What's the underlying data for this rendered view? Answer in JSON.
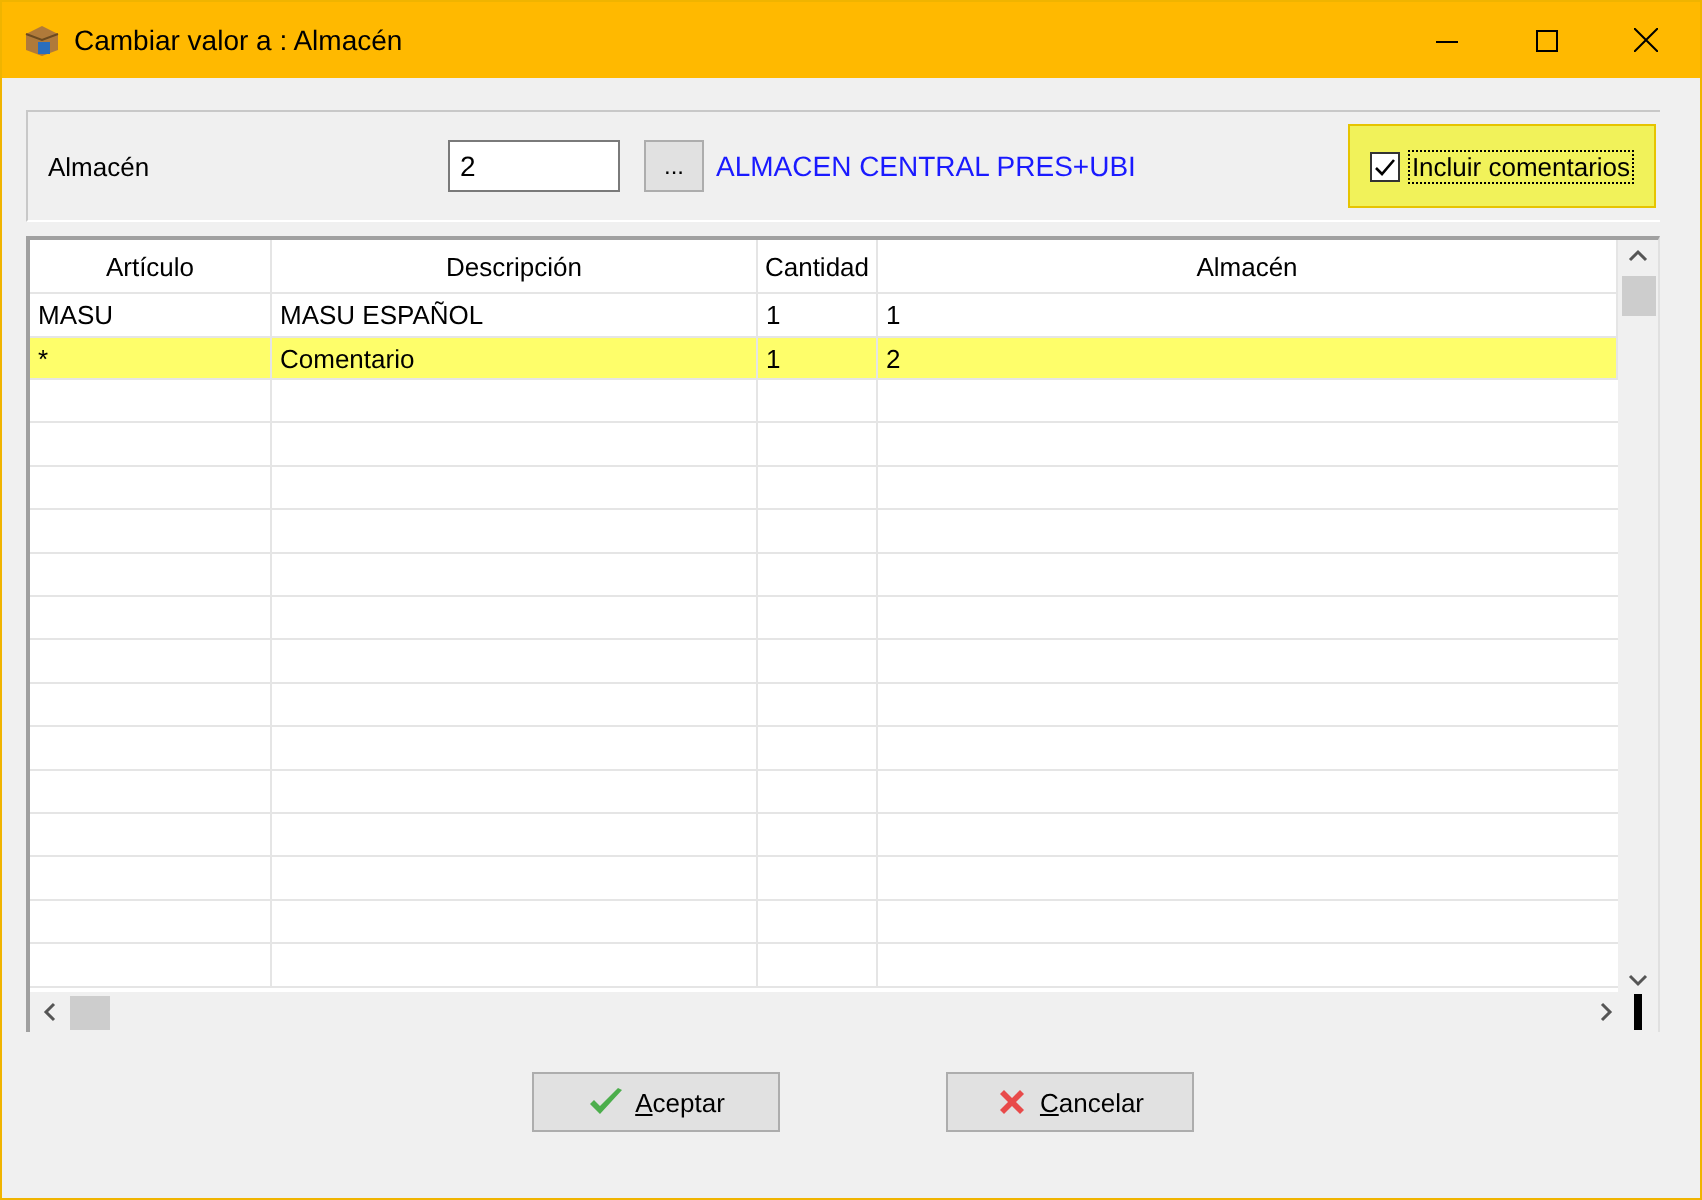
{
  "window": {
    "title": "Cambiar valor a : Almacén"
  },
  "filter": {
    "label": "Almacén",
    "value": "2",
    "browse_button": "...",
    "description": "ALMACEN CENTRAL PRES+UBI",
    "include_comments": {
      "label": "Incluir comentarios",
      "checked": true,
      "highlighted": true
    }
  },
  "table": {
    "columns": [
      "Artículo",
      "Descripción",
      "Cantidad",
      "Almacén"
    ],
    "rows": [
      {
        "cells": [
          "MASU",
          "MASU ESPAÑOL",
          "1",
          "1"
        ],
        "highlighted": false
      },
      {
        "cells": [
          "*",
          "Comentario",
          "1",
          "2"
        ],
        "highlighted": true
      }
    ]
  },
  "buttons": [
    {
      "label": "Aceptar",
      "kind": "ok"
    },
    {
      "label": "Cancelar",
      "kind": "cancel"
    }
  ]
}
